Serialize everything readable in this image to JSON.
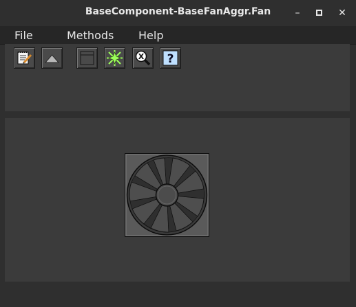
{
  "window": {
    "title": "BaseComponent-BaseFanAggr.Fan",
    "minimize_symbol": "–",
    "maximize_symbol": "▪",
    "close_symbol": "✕"
  },
  "menu": {
    "items": [
      {
        "label": "File"
      },
      {
        "label": "Methods"
      },
      {
        "label": "Help"
      }
    ]
  },
  "toolbar": {
    "buttons": [
      {
        "icon": "notepad-edit-icon"
      },
      {
        "icon": "triangle-up-icon"
      },
      {
        "icon": "window-icon"
      },
      {
        "icon": "starburst-icon"
      },
      {
        "icon": "magnifier-x-icon"
      },
      {
        "icon": "help-question-icon"
      }
    ],
    "help_glyph": "?",
    "magnifier_glyph": "X"
  },
  "colors": {
    "window_bg": "#2f2f2f",
    "panel_bg": "#3b3b3b",
    "menubar_bg": "#262626",
    "fan_face": "#5a5a5a",
    "help_icon_bg": "#bfe0ff",
    "starburst": "#9cff5a"
  },
  "main": {
    "component_icon": "fan-icon"
  }
}
